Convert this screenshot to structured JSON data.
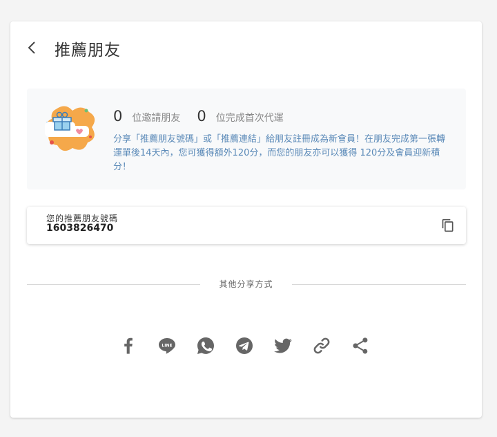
{
  "header": {
    "title": "推薦朋友"
  },
  "stats": {
    "invited_count": "0",
    "invited_label": "位邀請朋友",
    "completed_count": "0",
    "completed_label": "位完成首次代運"
  },
  "description": "分享「推薦朋友號碼」或「推薦連結」給朋友註冊成為新會員！在朋友完成第一張轉運單後14天內，您可獲得額外120分，而您的朋友亦可以獲得 120分及會員迎新積分！",
  "referral": {
    "label": "您的推薦朋友號碼",
    "code": "1603826470"
  },
  "share": {
    "divider_text": "其他分享方式",
    "icons": [
      "facebook-icon",
      "line-icon",
      "whatsapp-icon",
      "telegram-icon",
      "twitter-icon",
      "link-icon",
      "share-icon"
    ]
  },
  "colors": {
    "icon": "#666666",
    "description": "#5b8ab8",
    "info_bg": "#f8f9fa",
    "logo_orange": "#f5a84a"
  }
}
